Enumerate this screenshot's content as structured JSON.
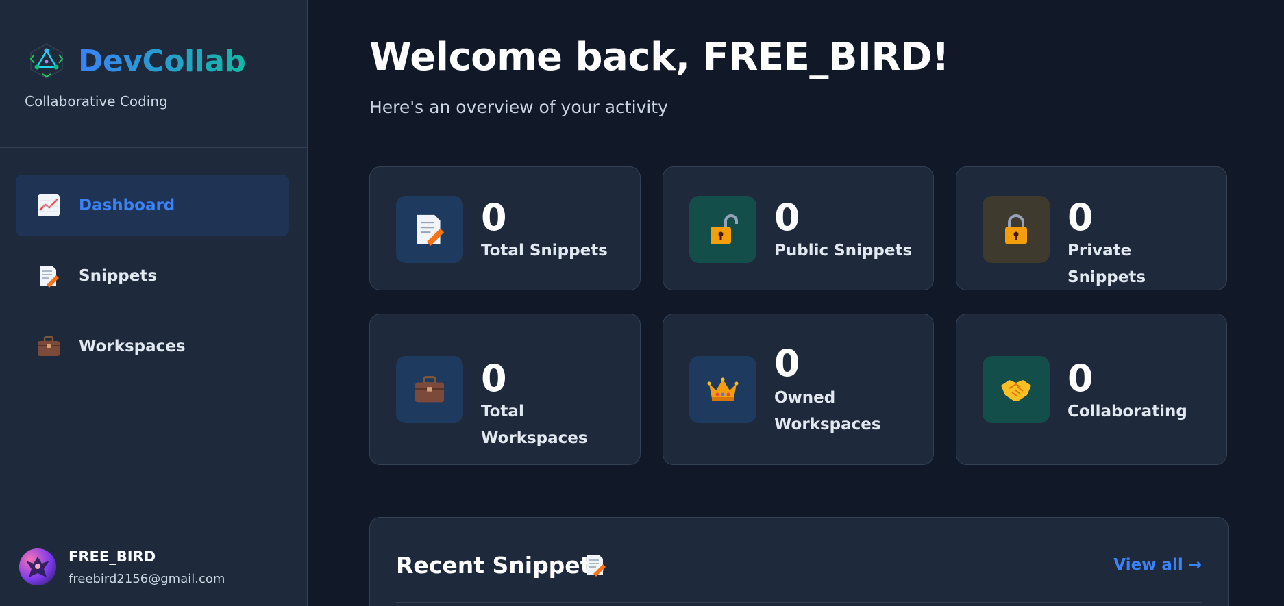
{
  "brand": {
    "name": "DevCollab",
    "tagline": "Collaborative Coding"
  },
  "nav": {
    "items": [
      {
        "label": "Dashboard",
        "icon": "chart-icon",
        "active": true
      },
      {
        "label": "Snippets",
        "icon": "memo-icon",
        "active": false
      },
      {
        "label": "Workspaces",
        "icon": "briefcase-icon",
        "active": false
      }
    ]
  },
  "user": {
    "name": "FREE_BIRD",
    "email": "freebird2156@gmail.com"
  },
  "header": {
    "title": "Welcome back, FREE_BIRD!",
    "subtitle": "Here's an overview of your activity"
  },
  "stats": [
    {
      "value": "0",
      "label": "Total Snippets",
      "icon": "memo-icon",
      "icon_bg": "#1e3a5f"
    },
    {
      "value": "0",
      "label": "Public Snippets",
      "icon": "unlocked-icon",
      "icon_bg": "#134e4a"
    },
    {
      "value": "0",
      "label": "Private Snippets",
      "icon": "locked-icon",
      "icon_bg": "#3f3a2e"
    },
    {
      "value": "0",
      "label": "Total Workspaces",
      "icon": "briefcase-icon",
      "icon_bg": "#1e3a5f"
    },
    {
      "value": "0",
      "label": "Owned Workspaces",
      "icon": "crown-icon",
      "icon_bg": "#1e3a5f"
    },
    {
      "value": "0",
      "label": "Collaborating",
      "icon": "handshake-icon",
      "icon_bg": "#134e4a"
    }
  ],
  "recent": {
    "title": "Recent Snippets",
    "view_all": "View all →"
  },
  "colors": {
    "accent": "#3b82f6",
    "background": "#111827",
    "surface": "#1e293b"
  }
}
